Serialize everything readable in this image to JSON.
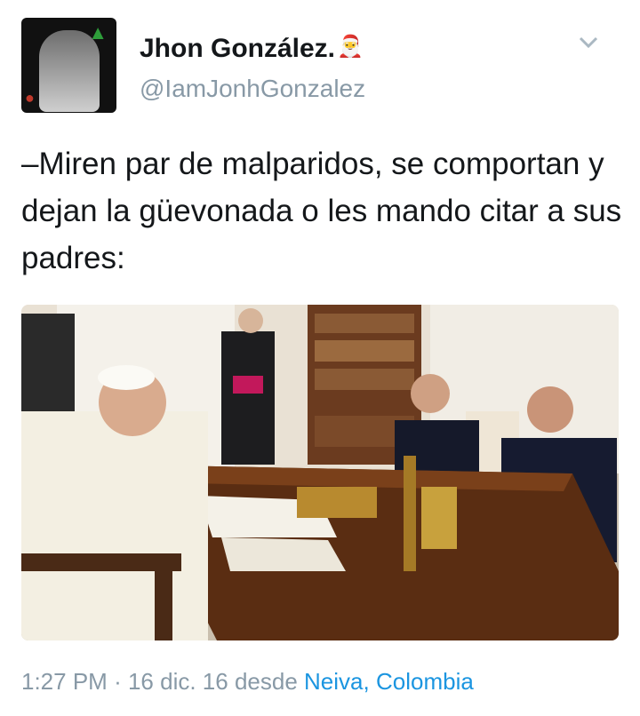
{
  "user": {
    "display_name": "Jhon González.",
    "handle": "@IamJonhGonzalez",
    "name_emoji": "santa-face-icon"
  },
  "tweet": {
    "text": "–Miren par de malparidos, se comportan y dejan la güevonada o les mando citar a sus padres:"
  },
  "footer": {
    "time": "1:27 PM",
    "separator": "·",
    "date": "16 dic. 16",
    "from_label": "desde",
    "city": "Neiva",
    "country": "Colombia"
  },
  "colors": {
    "text": "#14171a",
    "muted": "#8899a6",
    "link": "#1b95e0"
  }
}
